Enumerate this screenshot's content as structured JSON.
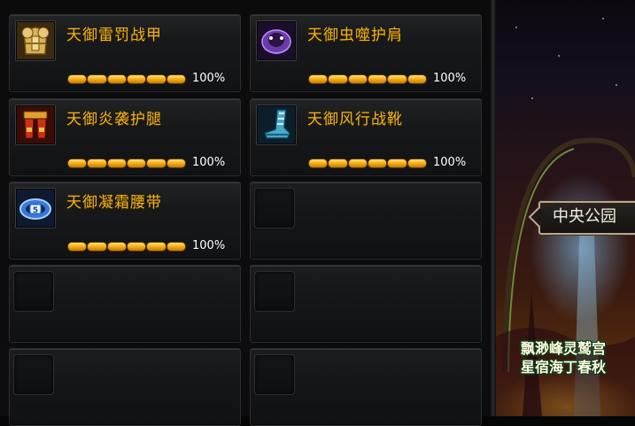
{
  "equipment": {
    "slots": [
      {
        "name": "天御雷罚战甲",
        "percent": "100%",
        "filled": true,
        "icon": "golden-armor-icon"
      },
      {
        "name": "天御虫噬护肩",
        "percent": "100%",
        "filled": true,
        "icon": "purple-shoulder-icon"
      },
      {
        "name": "天御炎袭护腿",
        "percent": "100%",
        "filled": true,
        "icon": "red-legguard-icon"
      },
      {
        "name": "天御风行战靴",
        "percent": "100%",
        "filled": true,
        "icon": "blue-boots-icon"
      },
      {
        "name": "天御凝霜腰带",
        "percent": "100%",
        "filled": true,
        "icon": "blue-belt-icon"
      },
      {
        "filled": false
      },
      {
        "filled": false
      },
      {
        "filled": false
      },
      {
        "filled": false
      },
      {
        "filled": false
      }
    ],
    "durability_fraction": 1.0
  },
  "scene": {
    "location_label": "中央公园",
    "lines": [
      "飘渺峰灵鹫宫",
      "星宿海丁春秋"
    ]
  },
  "colors": {
    "item_name": "#f2b316",
    "bar_fill": "#f8b21a",
    "panel_bg": "#0b0b0c"
  }
}
